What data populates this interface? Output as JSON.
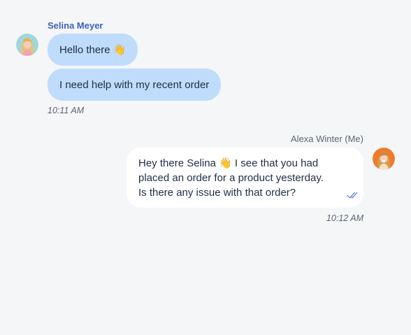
{
  "conversation": {
    "incoming": {
      "sender_name": "Selina Meyer",
      "messages": [
        "Hello there 👋",
        "I need help with my recent order"
      ],
      "time": "10:11 AM"
    },
    "outgoing": {
      "sender_name": "Alexa Winter (Me)",
      "lines": [
        "Hey there Selina 👋 I see that you had",
        "placed an order for a product yesterday.",
        "Is there any issue with that order?"
      ],
      "time": "10:12 AM",
      "status_icon": "double-check-icon"
    }
  },
  "colors": {
    "incoming_bubble": "#bfdcfd",
    "outgoing_bubble": "#ffffff",
    "sender_name": "#3a63b8",
    "background": "#f5f6f8",
    "read_check": "#6b8fd6"
  }
}
